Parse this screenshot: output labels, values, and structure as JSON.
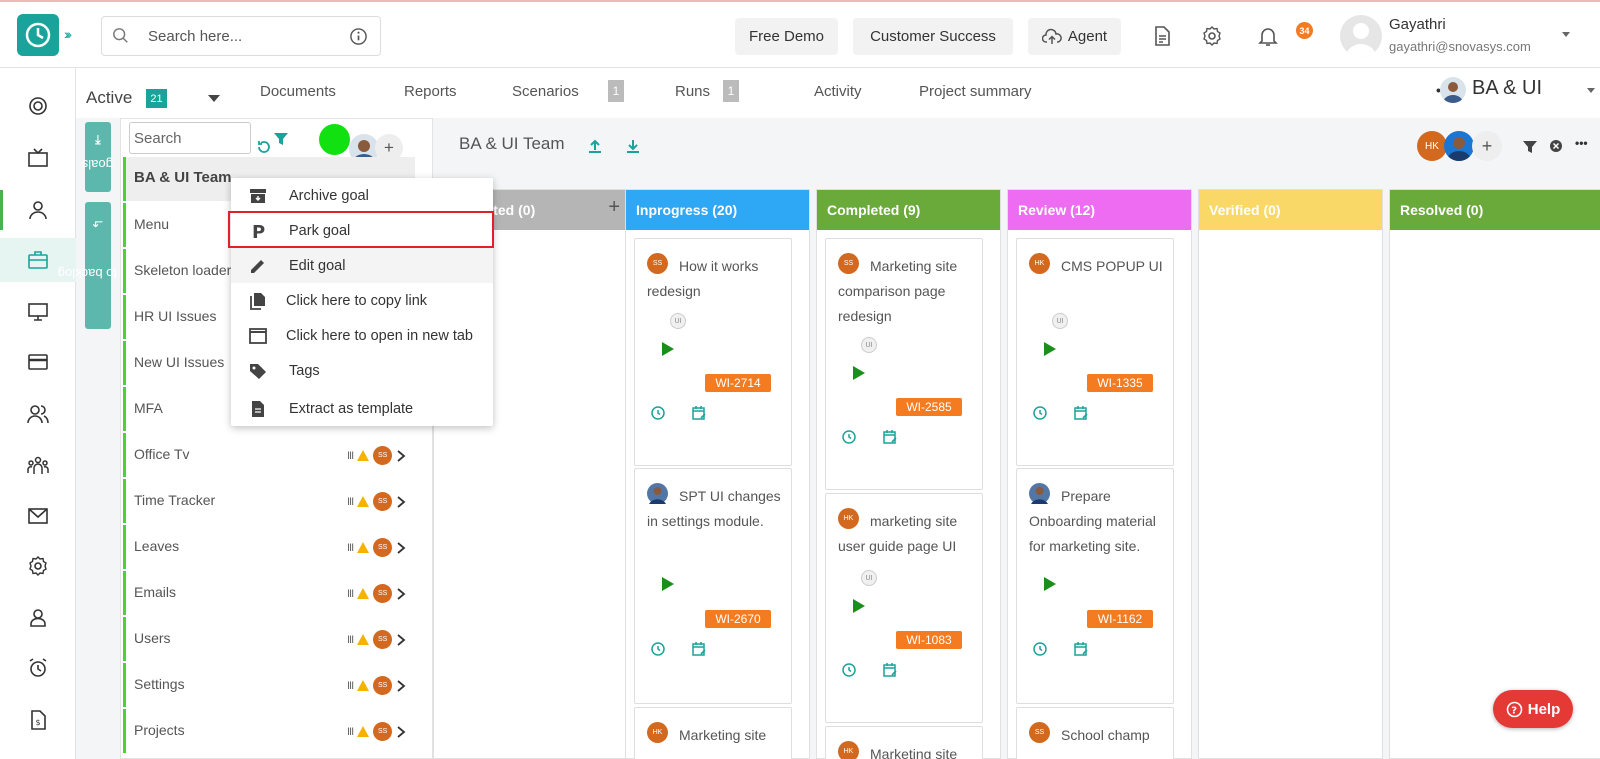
{
  "header": {
    "search_placeholder": "Search here...",
    "buttons": {
      "free_demo": "Free Demo",
      "customer_success": "Customer Success",
      "agent": "Agent"
    },
    "notifications": "34",
    "user": {
      "name": "Gayathri",
      "email": "gayathri@snovasys.com"
    }
  },
  "subtabs": {
    "active_label": "Active",
    "active_count": "21",
    "tabs": [
      {
        "label": "Documents",
        "badge": ""
      },
      {
        "label": "Reports",
        "badge": ""
      },
      {
        "label": "Scenarios",
        "badge": "1"
      },
      {
        "label": "Runs",
        "badge": "1"
      },
      {
        "label": "Activity",
        "badge": ""
      },
      {
        "label": "Project summary",
        "badge": ""
      }
    ],
    "more": "•••",
    "team_selector": "BA & UI"
  },
  "side_buttons": {
    "goals": "goals",
    "backlog": "Go to backlog"
  },
  "goals": {
    "search_placeholder": "Search",
    "items": [
      {
        "name": "BA & UI Team",
        "avatar": ""
      },
      {
        "name": "Menu",
        "avatar": ""
      },
      {
        "name": "Skeleton loader",
        "avatar": ""
      },
      {
        "name": "HR UI Issues",
        "avatar": ""
      },
      {
        "name": "New UI Issues",
        "avatar": ""
      },
      {
        "name": "MFA",
        "avatar": ""
      },
      {
        "name": "Office Tv",
        "avatar": "SS"
      },
      {
        "name": "Time Tracker",
        "avatar": "SS"
      },
      {
        "name": "Leaves",
        "avatar": "SS"
      },
      {
        "name": "Emails",
        "avatar": "SS"
      },
      {
        "name": "Users",
        "avatar": "SS"
      },
      {
        "name": "Settings",
        "avatar": "SS"
      },
      {
        "name": "Projects",
        "avatar": "SS"
      }
    ],
    "bars_glyph": "III"
  },
  "context_menu": {
    "items": [
      {
        "label": "Archive goal",
        "icon": "archive-icon"
      },
      {
        "label": "Park goal",
        "icon": "park-icon"
      },
      {
        "label": "Edit goal",
        "icon": "edit-icon"
      },
      {
        "label": "Click here to copy link",
        "icon": "copy-icon"
      },
      {
        "label": "Click here to open in new tab",
        "icon": "new-tab-icon"
      },
      {
        "label": "Tags",
        "icon": "tag-icon"
      },
      {
        "label": "Extract as template",
        "icon": "template-icon"
      }
    ]
  },
  "board": {
    "title": "BA & UI Team",
    "members": {
      "initials": "HK",
      "plus": "+"
    },
    "columns": [
      {
        "title": "arted (0)",
        "color": "#b5b5b5",
        "plus": "+"
      },
      {
        "title": "Inprogress (20)",
        "color": "#2ea7f5"
      },
      {
        "title": "Completed (9)",
        "color": "#6aaa3a"
      },
      {
        "title": "Review (12)",
        "color": "#ee6cf2"
      },
      {
        "title": "Verified (0)",
        "color": "#f9d867"
      },
      {
        "title": "Resolved (0)",
        "color": "#6aaa3a"
      }
    ],
    "cards": {
      "inprogress": [
        {
          "avatar": "SS",
          "title": "How it works redesign",
          "tag": "UI",
          "wi": "WI-2714"
        },
        {
          "avatar": "",
          "title": "SPT UI changes in settings module.",
          "tag": "",
          "wi": "WI-2670"
        },
        {
          "avatar": "HK",
          "title": "Marketing site",
          "tag": "",
          "wi": ""
        }
      ],
      "completed": [
        {
          "avatar": "SS",
          "title": "Marketing site comparison page redesign",
          "tag": "UI",
          "wi": "WI-2585"
        },
        {
          "avatar": "HK",
          "title": "marketing site user guide page UI",
          "tag": "UI",
          "wi": "WI-1083"
        },
        {
          "avatar": "HK",
          "title": "Marketing site",
          "tag": "",
          "wi": ""
        }
      ],
      "review": [
        {
          "avatar": "HK",
          "title": "CMS POPUP UI",
          "tag": "UI",
          "wi": "WI-1335"
        },
        {
          "avatar": "",
          "title": "Prepare Onboarding material for marketing site.",
          "tag": "",
          "wi": "WI-1162"
        },
        {
          "avatar": "SS",
          "title": "School champ",
          "tag": "",
          "wi": ""
        }
      ]
    }
  },
  "help": "Help",
  "colors": {
    "accent": "#1aa39a",
    "highlight": "#e0202a",
    "wi_badge": "#f47b20"
  }
}
